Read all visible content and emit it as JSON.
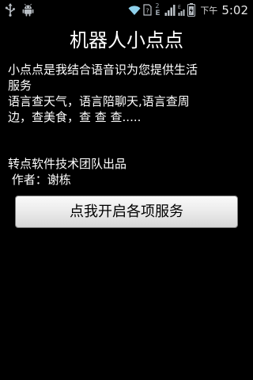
{
  "status_bar": {
    "icons_left": [
      "usb-icon",
      "android-debug-icon"
    ],
    "icons_right": [
      "wifi-icon",
      "sim-card-icon",
      "signal-icon",
      "signal-icon-2",
      "battery-icon"
    ],
    "sim_number": "2",
    "network_letter": "E",
    "ampm": "下午",
    "time": "5:02"
  },
  "app": {
    "title": "机器人小点点"
  },
  "description": {
    "lines": [
      "小点点是我结合语音识为您提供生活",
      "服务",
      "语言查天气，语言陪聊天,语言查周",
      "边，查美食，查 查 查....."
    ]
  },
  "credits": {
    "team": "转点软件技术团队出品",
    "author": " 作者：谢栋"
  },
  "action_button": {
    "label": "点我开启各项服务"
  },
  "colors": {
    "background": "#000000",
    "text": "#ffffff",
    "button_bg": "#e4e4e4",
    "button_text": "#000000",
    "status_icon": "#9aa3ac"
  }
}
